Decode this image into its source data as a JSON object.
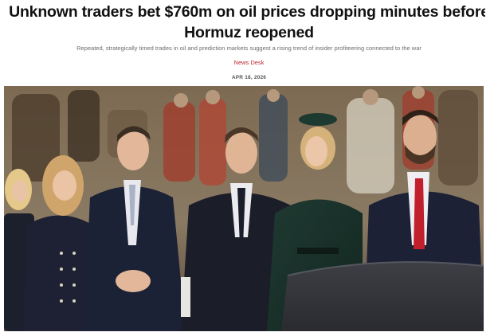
{
  "article": {
    "headline_line1": "Unknown traders bet $760m on oil prices dropping minutes before",
    "headline_line2": "Hormuz reopened",
    "subtitle": "Repeated, strategically timed trades in oil and prediction markets suggest a rising trend of insider profiteering connected to the war",
    "author": "News Desk",
    "date": "APR 18, 2026"
  },
  "colors": {
    "author_link": "#c0282d",
    "headline": "#111111",
    "subtitle": "#6b6b6b"
  }
}
